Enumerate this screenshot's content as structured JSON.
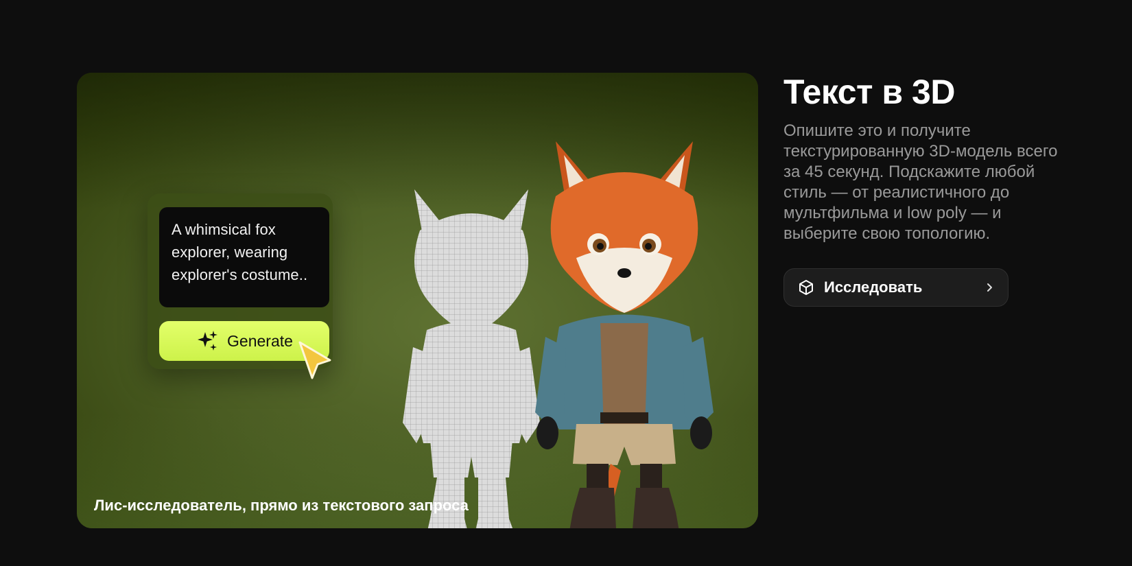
{
  "showcase": {
    "prompt_text": "A whimsical fox explorer, wearing explorer's costume..",
    "generate_label": "Generate",
    "caption": "Лис-исследователь, прямо из текстового запроса"
  },
  "info": {
    "title": "Текст в 3D",
    "description": "Опишите это и получите текстурированную 3D-модель всего за 45 секунд. Подскажите любой стиль — от реалистичного до мультфильма и low poly — и выберите свою топологию.",
    "explore_label": "Исследовать"
  },
  "icons": {
    "generate": "sparkles-icon",
    "cursor": "pointer-cursor-icon",
    "explore": "cube-icon",
    "chevron": "chevron-right-icon"
  },
  "colors": {
    "background": "#0e0e0e",
    "generate_button": "#d8f84f",
    "card_green": "#4a5c22",
    "description_text": "#9a9a9a"
  }
}
